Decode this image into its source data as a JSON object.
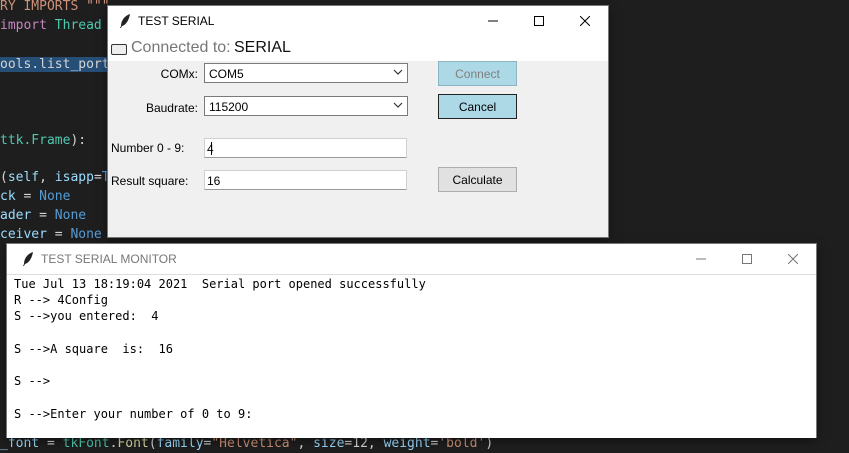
{
  "editor": {
    "lines": [
      {
        "row": "l1",
        "parts": [
          {
            "c": "k-str",
            "t": "RY IMPORTS \"\"\""
          }
        ]
      },
      {
        "row": "l2",
        "parts": [
          {
            "c": "k-kw",
            "t": "import"
          },
          {
            "c": "k-plain",
            "t": " "
          },
          {
            "c": "k-cls",
            "t": "Thread"
          }
        ]
      },
      {
        "row": "l3",
        "parts": [
          {
            "c": "k-plain hl",
            "t": "ools.list_ports"
          }
        ]
      },
      {
        "row": "l4",
        "parts": [
          {
            "c": "k-cls",
            "t": "ttk.Frame"
          },
          {
            "c": "k-plain",
            "t": "):"
          }
        ]
      },
      {
        "row": "l5",
        "parts": [
          {
            "c": "k-plain",
            "t": "("
          },
          {
            "c": "k-var",
            "t": "self"
          },
          {
            "c": "k-plain",
            "t": ", "
          },
          {
            "c": "k-var",
            "t": "isapp"
          },
          {
            "c": "k-plain",
            "t": "="
          },
          {
            "c": "k-const",
            "t": "T"
          }
        ]
      },
      {
        "row": "l6",
        "parts": [
          {
            "c": "k-var",
            "t": "ck"
          },
          {
            "c": "k-plain",
            "t": " = "
          },
          {
            "c": "k-const",
            "t": "None"
          }
        ]
      },
      {
        "row": "l7",
        "parts": [
          {
            "c": "k-var",
            "t": "ader"
          },
          {
            "c": "k-plain",
            "t": " = "
          },
          {
            "c": "k-const",
            "t": "None"
          }
        ]
      },
      {
        "row": "l8",
        "parts": [
          {
            "c": "k-var",
            "t": "ceiver"
          },
          {
            "c": "k-plain",
            "t": " = "
          },
          {
            "c": "k-const",
            "t": "None"
          }
        ]
      },
      {
        "row": "l9",
        "parts": [
          {
            "c": "k-var",
            "t": "_font"
          },
          {
            "c": "k-plain",
            "t": " = "
          },
          {
            "c": "k-cls",
            "t": "tkFont"
          },
          {
            "c": "k-plain",
            "t": "."
          },
          {
            "c": "k-fn",
            "t": "Font"
          },
          {
            "c": "k-plain",
            "t": "("
          },
          {
            "c": "k-var",
            "t": "family"
          },
          {
            "c": "k-plain",
            "t": "="
          },
          {
            "c": "k-str",
            "t": "\"Helvetica\""
          },
          {
            "c": "k-plain",
            "t": ", "
          },
          {
            "c": "k-var",
            "t": "size"
          },
          {
            "c": "k-plain",
            "t": "=12, "
          },
          {
            "c": "k-var",
            "t": "weight"
          },
          {
            "c": "k-plain",
            "t": "="
          },
          {
            "c": "k-str",
            "t": "'bold'"
          },
          {
            "c": "k-plain",
            "t": ")"
          }
        ]
      }
    ]
  },
  "serial_window": {
    "title": "TEST SERIAL",
    "status_label": "Connected to:",
    "status_value": "SERIAL",
    "comx_label": "COMx:",
    "comx_value": "COM5",
    "baud_label": "Baudrate:",
    "baud_value": "115200",
    "number_label": "Number 0 - 9:",
    "number_value": "4",
    "result_label": "Result square:",
    "result_value": "16",
    "connect_label": "Connect",
    "cancel_label": "Cancel",
    "calculate_label": "Calculate"
  },
  "monitor_window": {
    "title": "TEST SERIAL MONITOR",
    "lines": [
      "Tue Jul 13 18:19:04 2021  Serial port opened successfully",
      "R --> 4Config",
      "S -->you entered:  4",
      "",
      "S -->A square  is:  16",
      "",
      "S -->",
      "",
      "S -->Enter your number of 0 to 9:"
    ]
  }
}
